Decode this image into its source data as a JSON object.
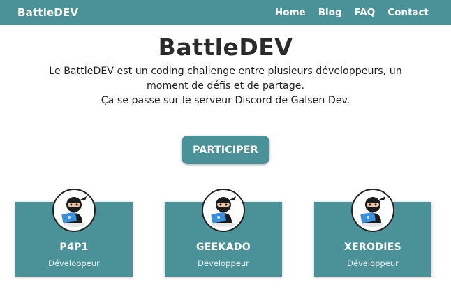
{
  "header": {
    "brand": "BattleDEV",
    "nav": [
      "Home",
      "Blog",
      "FAQ",
      "Contact"
    ]
  },
  "hero": {
    "title": "BattleDEV",
    "description_line1": "Le BattleDEV est un coding challenge entre plusieurs développeurs, un",
    "description_line2": "moment de défis et de partage.",
    "description_line3": "Ça se passe sur le serveur Discord de Galsen Dev.",
    "cta_label": "PARTICIPER"
  },
  "participants": [
    {
      "name": "P4P1",
      "role": "Développeur"
    },
    {
      "name": "GEEKADO",
      "role": "Développeur"
    },
    {
      "name": "XERODIES",
      "role": "Développeur"
    }
  ],
  "colors": {
    "accent": "#4a9297"
  },
  "icons": {
    "avatar": "ninja-laptop-icon"
  }
}
